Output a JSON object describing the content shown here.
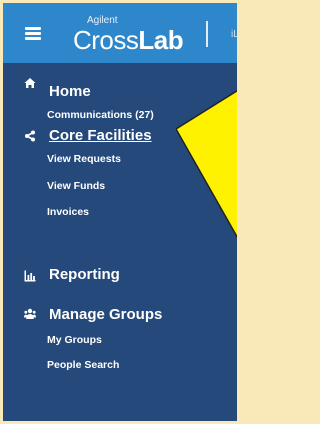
{
  "header": {
    "brand_small": "Agilent",
    "brand_thin": "Cross",
    "brand_bold": "Lab",
    "clipped_text": "iL",
    "bar_color": "#2e86cb"
  },
  "sidebar": {
    "background": "#25497b",
    "sections": [
      {
        "id": "home",
        "icon": "home-icon",
        "label": "Home",
        "items": [
          "Communications (27)"
        ]
      },
      {
        "id": "core-facilities",
        "icon": "share-icon",
        "label": "Core Facilities",
        "active": true,
        "items": [
          "View Requests",
          "View Funds",
          "Invoices"
        ]
      },
      {
        "id": "reporting",
        "icon": "bar-chart-icon",
        "label": "Reporting",
        "items": []
      },
      {
        "id": "manage-groups",
        "icon": "group-icon",
        "label": "Manage Groups",
        "items": [
          "My Groups",
          "People Search"
        ]
      }
    ]
  },
  "annotation": {
    "shape": "arrow-pointing-left",
    "color": "#fff200",
    "outline": "#222222"
  },
  "page_background": "#f9e9b8"
}
